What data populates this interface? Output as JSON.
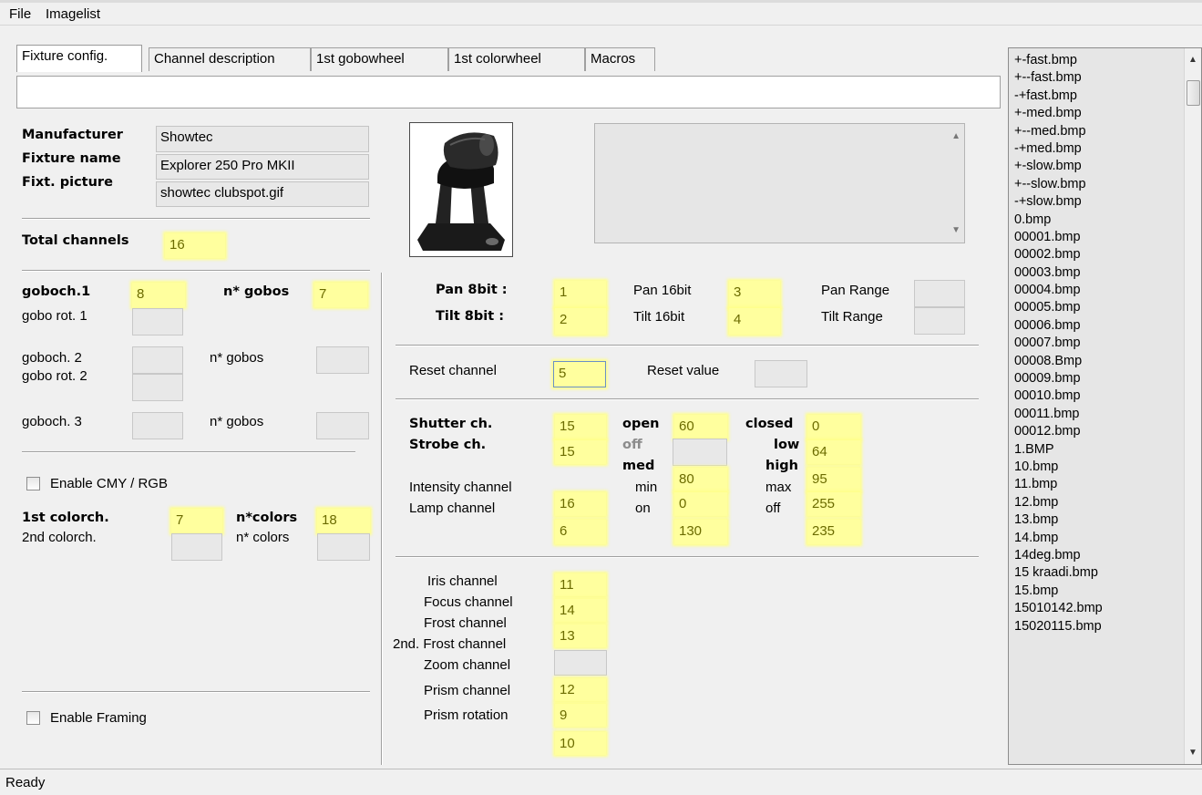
{
  "menu": [
    "File",
    "Imagelist"
  ],
  "tabs": [
    "Fixture config.",
    "Channel description",
    "1st gobowheel",
    "1st colorwheel",
    "Macros"
  ],
  "fixture": {
    "manufacturer_label": "Manufacturer",
    "manufacturer_value": "Showtec",
    "name_label": "Fixture name",
    "name_value": "Explorer 250 Pro MKII",
    "picture_label": "Fixt. picture",
    "picture_value": "showtec clubspot.gif",
    "picture_icon": "moving-head-light-icon",
    "total_channels_label": "Total channels",
    "total_channels_value": "16"
  },
  "gobo": {
    "goboch1_label": "goboch.1",
    "goboch1_value": "8",
    "ngobos1_label": "n* gobos",
    "ngobos1_value": "7",
    "gobo_rot1_label": "gobo rot. 1",
    "goboch2_label": "goboch. 2",
    "ngobos2_label": "n* gobos",
    "gobo_rot2_label": "gobo rot. 2",
    "goboch3_label": "goboch. 3",
    "ngobos3_label": "n* gobos"
  },
  "color": {
    "enable_cmy_label": "Enable CMY / RGB",
    "colorch1_label": "1st colorch.",
    "colorch1_value": "7",
    "ncolors1_label": "n*colors",
    "ncolors1_value": "18",
    "colorch2_label": "2nd colorch.",
    "ncolors2_label": "n* colors"
  },
  "framing": {
    "enable_label": "Enable Framing"
  },
  "pantilt": {
    "pan8_label": "Pan 8bit :",
    "pan8_value": "1",
    "tilt8_label": "Tilt 8bit :",
    "tilt8_value": "2",
    "pan16_label": "Pan 16bit",
    "pan16_value": "3",
    "tilt16_label": "Tilt 16bit",
    "tilt16_value": "4",
    "pan_range_label": "Pan Range",
    "tilt_range_label": "Tilt Range"
  },
  "reset": {
    "channel_label": "Reset channel",
    "channel_value": "5",
    "value_label": "Reset value"
  },
  "shutter": {
    "shutter_label": "Shutter ch.",
    "shutter_value": "15",
    "open_label": "open",
    "open_value": "60",
    "closed_label": "closed",
    "closed_value": "0",
    "strobe_label": "Strobe ch.",
    "strobe_value": "15",
    "off_label": "off",
    "low_label": "low",
    "low_value": "64",
    "med_label": "med",
    "med_value": "80",
    "high_label": "high",
    "high_value": "95",
    "intensity_label": "Intensity channel",
    "intensity_value": "16",
    "min_label": "min",
    "min_value": "0",
    "max_label": "max",
    "max_value": "255",
    "lamp_label": "Lamp channel",
    "lamp_value": "6",
    "on_label": "on",
    "on_value": "130",
    "lamp_off_label": "off",
    "lamp_off_value": "235"
  },
  "effects": {
    "iris_label": "Iris channel",
    "iris_value": "11",
    "focus_label": "Focus channel",
    "focus_value": "14",
    "frost_label": "Frost channel",
    "frost_value": "13",
    "frost2_label": "2nd. Frost channel",
    "zoom_label": "Zoom channel",
    "zoom_value": "12",
    "prism_label": "Prism channel",
    "prism_value": "9",
    "prism_rot_label": "Prism rotation",
    "prism_rot_value": "10"
  },
  "imagelist": [
    "+-fast.bmp",
    "+--fast.bmp",
    "-+fast.bmp",
    "+-med.bmp",
    "+--med.bmp",
    "-+med.bmp",
    "+-slow.bmp",
    "+--slow.bmp",
    "-+slow.bmp",
    "0.bmp",
    "00001.bmp",
    "00002.bmp",
    "00003.bmp",
    "00004.bmp",
    "00005.bmp",
    "00006.bmp",
    "00007.bmp",
    "00008.Bmp",
    "00009.bmp",
    "00010.bmp",
    "00011.bmp",
    "00012.bmp",
    "1.BMP",
    "10.bmp",
    "11.bmp",
    "12.bmp",
    "13.bmp",
    "14.bmp",
    "14deg.bmp",
    "15 kraadi.bmp",
    "15.bmp",
    "15010142.bmp",
    "15020115.bmp"
  ],
  "status": "Ready",
  "highlight_color": "#ffff9e"
}
